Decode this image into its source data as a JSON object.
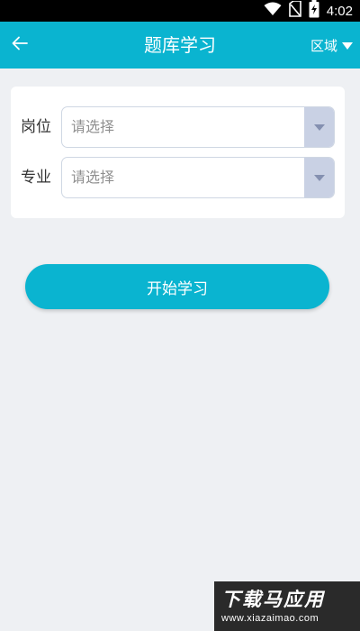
{
  "status_bar": {
    "time": "4:02",
    "icons": [
      "wifi-icon",
      "no-sim-icon",
      "battery-charging-icon"
    ]
  },
  "app_bar": {
    "back_icon": "arrow-left-icon",
    "title": "题库学习",
    "region_label": "区域",
    "region_icon": "caret-down-icon"
  },
  "form": {
    "fields": [
      {
        "label": "岗位",
        "placeholder": "请选择",
        "arrow_icon": "dropdown-arrow-icon"
      },
      {
        "label": "专业",
        "placeholder": "请选择",
        "arrow_icon": "dropdown-arrow-icon"
      }
    ]
  },
  "actions": {
    "start_label": "开始学习"
  },
  "watermark": {
    "title": "下载马应用",
    "url": "www.xiazaimao.com"
  },
  "colors": {
    "primary": "#0ab4d0",
    "background": "#eef0f3",
    "select_border": "#cfd7e3",
    "select_arrow_bg": "#c9d1e4",
    "placeholder": "#8f8f8f"
  }
}
